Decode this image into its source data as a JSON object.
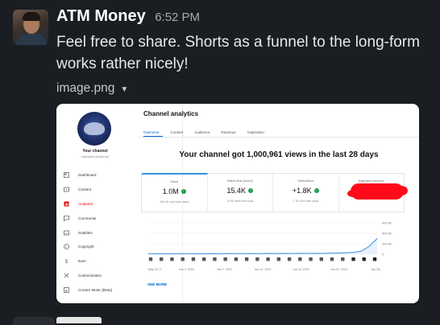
{
  "message": {
    "sender": "ATM Money",
    "time": "6:52 PM",
    "text": "Feel free to share. Shorts as a funnel to the long-form works rather nicely!",
    "attachment": {
      "filename": "image.png"
    }
  },
  "screenshot": {
    "page_title": "Channel analytics",
    "channel": {
      "title": "Your channel",
      "subtitle": "Maverick Academy"
    },
    "nav": [
      {
        "label": "Dashboard",
        "icon": "dashboard-icon",
        "active": false
      },
      {
        "label": "Content",
        "icon": "content-icon",
        "active": false
      },
      {
        "label": "Analytics",
        "icon": "analytics-icon",
        "active": true
      },
      {
        "label": "Comments",
        "icon": "comments-icon",
        "active": false
      },
      {
        "label": "Subtitles",
        "icon": "subtitles-icon",
        "active": false
      },
      {
        "label": "Copyright",
        "icon": "copyright-icon",
        "active": false
      },
      {
        "label": "Earn",
        "icon": "earn-icon",
        "active": false
      },
      {
        "label": "Customization",
        "icon": "customization-icon",
        "active": false
      },
      {
        "label": "Creator Music [Beta]",
        "icon": "music-icon",
        "active": false
      }
    ],
    "tabs": [
      "Overview",
      "Content",
      "Audience",
      "Revenue",
      "Inspiration"
    ],
    "headline": "Your channel got 1,000,961 views in the last 28 days",
    "stats": [
      {
        "label": "Views",
        "value": "1.0M",
        "note": "961.6K more than usual",
        "up": true
      },
      {
        "label": "Watch time (hours)",
        "value": "15.4K",
        "note": "14.3K more than usual",
        "up": true
      },
      {
        "label": "Subscribers",
        "value": "+1.8K",
        "note": "1.7K more than usual",
        "up": true
      },
      {
        "label": "Estimated revenue",
        "value": "",
        "note": "",
        "redacted": true
      }
    ],
    "see_more": "SEE MORE",
    "colors": {
      "accent": "#3f8de0",
      "active_nav": "#e00000",
      "up_badge": "#1a9e4a",
      "redaction": "#ff0a1a"
    }
  },
  "chart_data": {
    "type": "line",
    "x": [
      "May 29, 2...",
      "Jun 3, 2024",
      "Jun 7, 2024",
      "Jun 12, 2024",
      "Jun 16, 2024",
      "Jun 21, 2024",
      "Jun 25,..."
    ],
    "yticks": [
      "600.0K",
      "400.0K",
      "200.0K",
      "0"
    ],
    "ylim": [
      0,
      600000
    ],
    "series": [
      {
        "values": [
          8000,
          9000,
          8500,
          10000,
          9000,
          11000,
          10000,
          9500,
          12000,
          10000,
          13000,
          11000,
          12000,
          14000,
          12000,
          15000,
          13000,
          16000,
          14000,
          17000,
          15000,
          18000,
          16000,
          20000,
          22000,
          26000,
          35000,
          60000,
          150000,
          300000
        ]
      }
    ]
  }
}
